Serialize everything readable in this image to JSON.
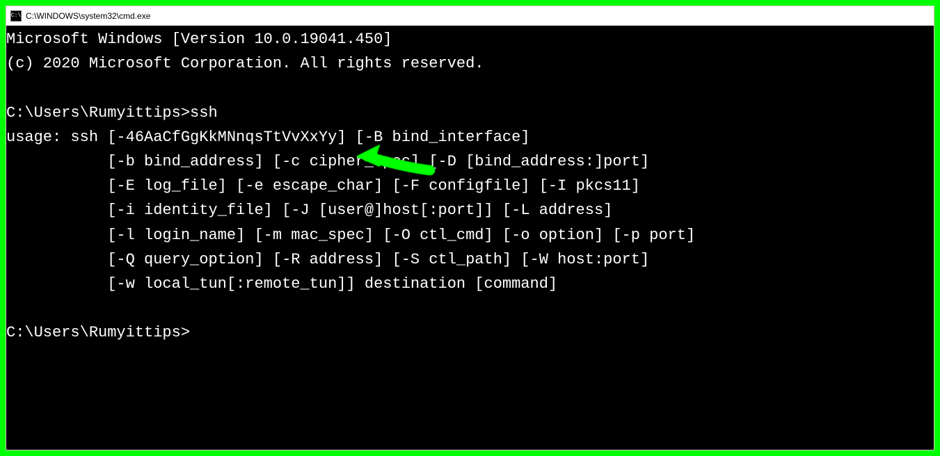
{
  "window": {
    "title": "C:\\WINDOWS\\system32\\cmd.exe",
    "icon_name": "cmd-icon"
  },
  "terminal": {
    "lines": [
      "Microsoft Windows [Version 10.0.19041.450]",
      "(c) 2020 Microsoft Corporation. All rights reserved.",
      "",
      "C:\\Users\\Rumyittips>ssh",
      "usage: ssh [-46AaCfGgKkMNnqsTtVvXxYy] [-B bind_interface]",
      "           [-b bind_address] [-c cipher_spec] [-D [bind_address:]port]",
      "           [-E log_file] [-e escape_char] [-F configfile] [-I pkcs11]",
      "           [-i identity_file] [-J [user@]host[:port]] [-L address]",
      "           [-l login_name] [-m mac_spec] [-O ctl_cmd] [-o option] [-p port]",
      "           [-Q query_option] [-R address] [-S ctl_path] [-W host:port]",
      "           [-w local_tun[:remote_tun]] destination [command]",
      "",
      "C:\\Users\\Rumyittips>"
    ]
  },
  "annotation": {
    "arrow_color": "#00ff00"
  }
}
